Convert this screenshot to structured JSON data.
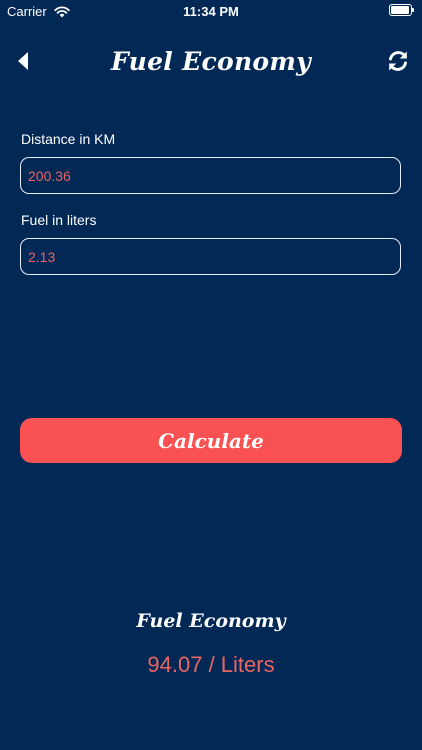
{
  "status_bar": {
    "carrier": "Carrier",
    "time": "11:34 PM",
    "wifi_icon": "wifi-icon",
    "battery_icon": "battery-icon"
  },
  "nav": {
    "title": "Fuel Economy",
    "back_icon": "back-arrow-icon",
    "refresh_icon": "refresh-icon"
  },
  "form": {
    "distance_label": "Distance in KM",
    "distance_value": "200.36",
    "fuel_label": "Fuel in liters",
    "fuel_value": "2.13"
  },
  "calculate_label": "Calculate",
  "result": {
    "title": "Fuel Economy",
    "value": "94.07 / Liters"
  },
  "colors": {
    "background": "#022856",
    "accent": "#fa5252",
    "value_text": "#e96564",
    "text": "#ffffff"
  }
}
